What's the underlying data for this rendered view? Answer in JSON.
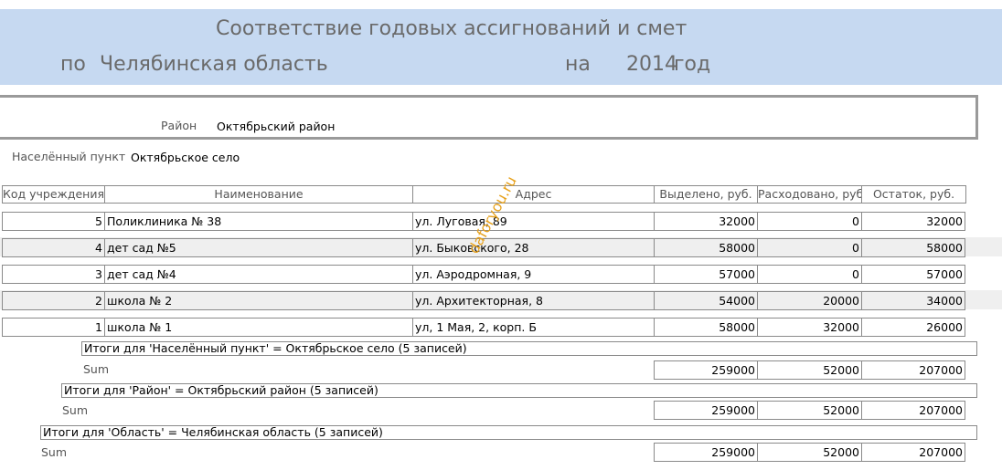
{
  "header": {
    "title": "Соответствие годовых ассигнований и смет",
    "by_label": "по",
    "region": "Челябинская область",
    "on_label": "на",
    "year": "2014",
    "year_unit": "год"
  },
  "district": {
    "label": "Район",
    "value": "Октябрьский район"
  },
  "locality": {
    "label": "Населённый пункт",
    "value": "Октябрьское село"
  },
  "columns": [
    "Код учреждения",
    "Наименование",
    "Адрес",
    "Выделено, руб.",
    "Расходовано, руб",
    "Остаток, руб."
  ],
  "rows": [
    {
      "code": "5",
      "name": "Поликлиника № 38",
      "address": "ул. Луговая, 89",
      "allocated": "32000",
      "spent": "0",
      "balance": "32000"
    },
    {
      "code": "4",
      "name": "дет сад  №5",
      "address": "ул. Быковского, 28",
      "allocated": "58000",
      "spent": "0",
      "balance": "58000"
    },
    {
      "code": "3",
      "name": "дет сад №4",
      "address": "ул. Аэродромная, 9",
      "allocated": "57000",
      "spent": "0",
      "balance": "57000"
    },
    {
      "code": "2",
      "name": "школа № 2",
      "address": "ул. Архитекторная, 8",
      "allocated": "54000",
      "spent": "20000",
      "balance": "34000"
    },
    {
      "code": "1",
      "name": "школа № 1",
      "address": "ул, 1 Мая, 2, корп. Б",
      "allocated": "58000",
      "spent": "32000",
      "balance": "26000"
    }
  ],
  "groups": [
    {
      "caption": "Итоги для 'Населённый пункт' =  Октябрьское село (5 записей)",
      "sum_label": "Sum",
      "allocated": "259000",
      "spent": "52000",
      "balance": "207000"
    },
    {
      "caption": "Итоги для 'Район' = Октябрьский район (5 записей)",
      "sum_label": "Sum",
      "allocated": "259000",
      "spent": "52000",
      "balance": "207000"
    },
    {
      "caption": "Итоги для 'Область' = Челябинская область (5 записей)",
      "sum_label": "Sum",
      "allocated": "259000",
      "spent": "52000",
      "balance": "207000"
    }
  ],
  "watermark": "daforyou.ru"
}
